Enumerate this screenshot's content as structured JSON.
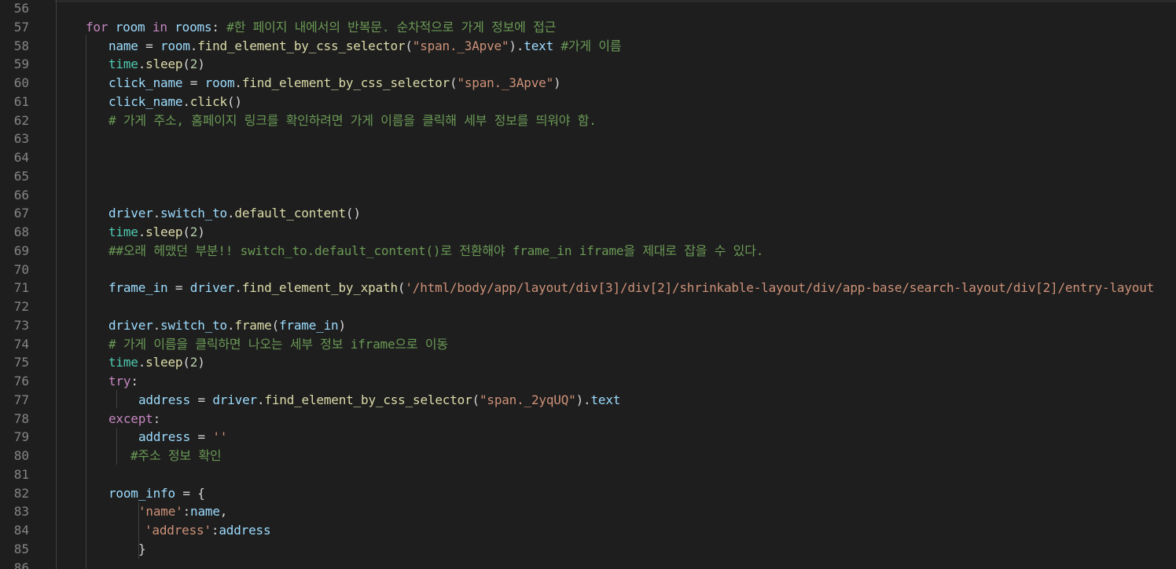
{
  "editor": {
    "lines": [
      {
        "n": "56",
        "indent": 0,
        "tokens": []
      },
      {
        "n": "57",
        "indent": 1,
        "tokens": [
          {
            "t": "for",
            "c": "kw"
          },
          {
            "t": " ",
            "c": "op"
          },
          {
            "t": "room",
            "c": "var"
          },
          {
            "t": " ",
            "c": "op"
          },
          {
            "t": "in",
            "c": "kw"
          },
          {
            "t": " ",
            "c": "op"
          },
          {
            "t": "rooms",
            "c": "var"
          },
          {
            "t": ": ",
            "c": "op"
          },
          {
            "t": "#한 페이지 내에서의 반복문. 순차적으로 가게 정보에 접근",
            "c": "cm"
          }
        ]
      },
      {
        "n": "58",
        "indent": 2,
        "tokens": [
          {
            "t": "name",
            "c": "var"
          },
          {
            "t": " = ",
            "c": "op"
          },
          {
            "t": "room",
            "c": "var"
          },
          {
            "t": ".",
            "c": "op"
          },
          {
            "t": "find_element_by_css_selector",
            "c": "fn"
          },
          {
            "t": "(",
            "c": "op"
          },
          {
            "t": "\"span._3Apve\"",
            "c": "str"
          },
          {
            "t": ").",
            "c": "op"
          },
          {
            "t": "text",
            "c": "var"
          },
          {
            "t": " ",
            "c": "op"
          },
          {
            "t": "#가게 이름",
            "c": "cm"
          }
        ]
      },
      {
        "n": "59",
        "indent": 2,
        "tokens": [
          {
            "t": "time",
            "c": "mod"
          },
          {
            "t": ".",
            "c": "op"
          },
          {
            "t": "sleep",
            "c": "fn"
          },
          {
            "t": "(",
            "c": "op"
          },
          {
            "t": "2",
            "c": "num"
          },
          {
            "t": ")",
            "c": "op"
          }
        ]
      },
      {
        "n": "60",
        "indent": 2,
        "tokens": [
          {
            "t": "click_name",
            "c": "var"
          },
          {
            "t": " = ",
            "c": "op"
          },
          {
            "t": "room",
            "c": "var"
          },
          {
            "t": ".",
            "c": "op"
          },
          {
            "t": "find_element_by_css_selector",
            "c": "fn"
          },
          {
            "t": "(",
            "c": "op"
          },
          {
            "t": "\"span._3Apve\"",
            "c": "str"
          },
          {
            "t": ")",
            "c": "op"
          }
        ]
      },
      {
        "n": "61",
        "indent": 2,
        "tokens": [
          {
            "t": "click_name",
            "c": "var"
          },
          {
            "t": ".",
            "c": "op"
          },
          {
            "t": "click",
            "c": "fn"
          },
          {
            "t": "()",
            "c": "op"
          }
        ]
      },
      {
        "n": "62",
        "indent": 2,
        "tokens": [
          {
            "t": "# 가게 주소, 홈페이지 링크를 확인하려면 가게 이름을 클릭해 세부 정보를 띄워야 함.",
            "c": "cm"
          }
        ]
      },
      {
        "n": "63",
        "indent": 2,
        "tokens": []
      },
      {
        "n": "64",
        "indent": 2,
        "tokens": []
      },
      {
        "n": "65",
        "indent": 2,
        "tokens": []
      },
      {
        "n": "66",
        "indent": 2,
        "tokens": []
      },
      {
        "n": "67",
        "indent": 2,
        "tokens": [
          {
            "t": "driver",
            "c": "var"
          },
          {
            "t": ".",
            "c": "op"
          },
          {
            "t": "switch_to",
            "c": "var"
          },
          {
            "t": ".",
            "c": "op"
          },
          {
            "t": "default_content",
            "c": "fn"
          },
          {
            "t": "()",
            "c": "op"
          }
        ]
      },
      {
        "n": "68",
        "indent": 2,
        "tokens": [
          {
            "t": "time",
            "c": "mod"
          },
          {
            "t": ".",
            "c": "op"
          },
          {
            "t": "sleep",
            "c": "fn"
          },
          {
            "t": "(",
            "c": "op"
          },
          {
            "t": "2",
            "c": "num"
          },
          {
            "t": ")",
            "c": "op"
          }
        ]
      },
      {
        "n": "69",
        "indent": 2,
        "tokens": [
          {
            "t": "##오래 헤맸던 부분!! switch_to.default_content()로 전환해야 frame_in iframe을 제대로 잡을 수 있다.",
            "c": "cm"
          }
        ]
      },
      {
        "n": "70",
        "indent": 2,
        "tokens": []
      },
      {
        "n": "71",
        "indent": 2,
        "tokens": [
          {
            "t": "frame_in",
            "c": "var"
          },
          {
            "t": " = ",
            "c": "op"
          },
          {
            "t": "driver",
            "c": "var"
          },
          {
            "t": ".",
            "c": "op"
          },
          {
            "t": "find_element_by_xpath",
            "c": "fn"
          },
          {
            "t": "(",
            "c": "op"
          },
          {
            "t": "'/html/body/app/layout/div[3]/div[2]/shrinkable-layout/div/app-base/search-layout/div[2]/entry-layout",
            "c": "str"
          }
        ]
      },
      {
        "n": "72",
        "indent": 2,
        "tokens": []
      },
      {
        "n": "73",
        "indent": 2,
        "tokens": [
          {
            "t": "driver",
            "c": "var"
          },
          {
            "t": ".",
            "c": "op"
          },
          {
            "t": "switch_to",
            "c": "var"
          },
          {
            "t": ".",
            "c": "op"
          },
          {
            "t": "frame",
            "c": "fn"
          },
          {
            "t": "(",
            "c": "op"
          },
          {
            "t": "frame_in",
            "c": "var"
          },
          {
            "t": ")",
            "c": "op"
          }
        ]
      },
      {
        "n": "74",
        "indent": 2,
        "tokens": [
          {
            "t": "# 가게 이름을 클릭하면 나오는 세부 정보 iframe으로 이동",
            "c": "cm"
          }
        ]
      },
      {
        "n": "75",
        "indent": 2,
        "tokens": [
          {
            "t": "time",
            "c": "mod"
          },
          {
            "t": ".",
            "c": "op"
          },
          {
            "t": "sleep",
            "c": "fn"
          },
          {
            "t": "(",
            "c": "op"
          },
          {
            "t": "2",
            "c": "num"
          },
          {
            "t": ")",
            "c": "op"
          }
        ]
      },
      {
        "n": "76",
        "indent": 2,
        "tokens": [
          {
            "t": "try",
            "c": "kw"
          },
          {
            "t": ":",
            "c": "op"
          }
        ]
      },
      {
        "n": "77",
        "indent": 3,
        "tokens": [
          {
            "t": "address",
            "c": "var"
          },
          {
            "t": " = ",
            "c": "op"
          },
          {
            "t": "driver",
            "c": "var"
          },
          {
            "t": ".",
            "c": "op"
          },
          {
            "t": "find_element_by_css_selector",
            "c": "fn"
          },
          {
            "t": "(",
            "c": "op"
          },
          {
            "t": "\"span._2yqUQ\"",
            "c": "str"
          },
          {
            "t": ").",
            "c": "op"
          },
          {
            "t": "text",
            "c": "var"
          }
        ]
      },
      {
        "n": "78",
        "indent": 2,
        "tokens": [
          {
            "t": "except",
            "c": "kw"
          },
          {
            "t": ":",
            "c": "op"
          }
        ]
      },
      {
        "n": "79",
        "indent": 3,
        "tokens": [
          {
            "t": "address",
            "c": "var"
          },
          {
            "t": " = ",
            "c": "op"
          },
          {
            "t": "''",
            "c": "str"
          }
        ]
      },
      {
        "n": "80",
        "indent": 3,
        "offset": -10,
        "tokens": [
          {
            "t": "#주소 정보 확인",
            "c": "cm"
          }
        ]
      },
      {
        "n": "81",
        "indent": 2,
        "tokens": []
      },
      {
        "n": "82",
        "indent": 2,
        "tokens": [
          {
            "t": "room_info",
            "c": "var"
          },
          {
            "t": " = {",
            "c": "op"
          }
        ]
      },
      {
        "n": "83",
        "indent": 3,
        "tokens": [
          {
            "t": "'name'",
            "c": "str"
          },
          {
            "t": ":",
            "c": "op"
          },
          {
            "t": "name",
            "c": "var"
          },
          {
            "t": ",",
            "c": "op"
          }
        ]
      },
      {
        "n": "84",
        "indent": 3,
        "offset": 8,
        "tokens": [
          {
            "t": "'address'",
            "c": "str"
          },
          {
            "t": ":",
            "c": "op"
          },
          {
            "t": "address",
            "c": "var"
          }
        ]
      },
      {
        "n": "85",
        "indent": 3,
        "tokens": [
          {
            "t": "}",
            "c": "op"
          }
        ]
      },
      {
        "n": "86",
        "indent": 0,
        "tokens": []
      }
    ]
  }
}
